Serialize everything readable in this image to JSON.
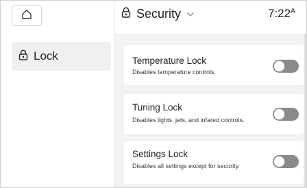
{
  "sidebar": {
    "home_icon": "home-icon",
    "items": [
      {
        "label": "Lock",
        "icon": "lock-icon",
        "selected": true
      }
    ]
  },
  "header": {
    "title": "Security",
    "title_icon": "lock-icon",
    "dropdown_icon": "chevron-down-icon",
    "clock": "7:22",
    "clock_suffix": "A"
  },
  "main": {
    "settings": [
      {
        "title": "Temperature Lock",
        "description": "Disables temperature controls.",
        "enabled": false
      },
      {
        "title": "Tuning Lock",
        "description": "Disables lights, jets, and infared controls.",
        "enabled": false
      },
      {
        "title": "Settings Lock",
        "description": "Disables all settings except for security.",
        "enabled": false
      }
    ]
  },
  "colors": {
    "background": "#f2f2f2",
    "card": "#ffffff",
    "sidebar_selected": "#f0f0f0",
    "toggle_off": "#8a8a8a",
    "text": "#1f1f1f"
  }
}
